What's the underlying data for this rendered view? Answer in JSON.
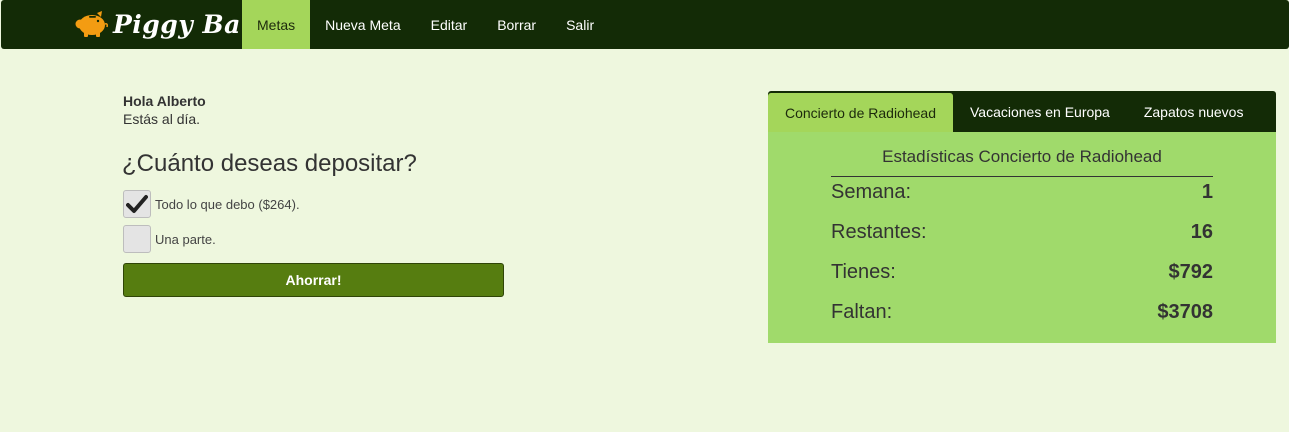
{
  "brand": {
    "name": "Piggy Bank",
    "icon": "piggy-bank-icon"
  },
  "nav": {
    "items": [
      {
        "label": "Metas",
        "active": true
      },
      {
        "label": "Nueva Meta",
        "active": false
      },
      {
        "label": "Editar",
        "active": false
      },
      {
        "label": "Borrar",
        "active": false
      },
      {
        "label": "Salir",
        "active": false
      }
    ]
  },
  "greeting": {
    "name": "Hola Alberto",
    "status": "Estás al día."
  },
  "deposit": {
    "question": "¿Cuánto deseas depositar?",
    "options": [
      {
        "label": "Todo lo que debo ($264).",
        "checked": true
      },
      {
        "label": "Una parte.",
        "checked": false
      }
    ],
    "button_label": "Ahorrar!"
  },
  "goals": {
    "tabs": [
      {
        "label": "Concierto de Radiohead",
        "active": true
      },
      {
        "label": "Vacaciones en Europa",
        "active": false
      },
      {
        "label": "Zapatos nuevos",
        "active": false
      }
    ],
    "stats": {
      "title": "Estadísticas Concierto de Radiohead",
      "rows": [
        {
          "label": "Semana:",
          "value": "1"
        },
        {
          "label": "Restantes:",
          "value": "16"
        },
        {
          "label": "Tienes:",
          "value": "$792"
        },
        {
          "label": "Faltan:",
          "value": "$3708"
        }
      ]
    }
  },
  "colors": {
    "navbar": "#132b06",
    "accent": "#a4d65a",
    "page_background": "#eef7de",
    "button": "#567d10",
    "panel": "#a0da6b",
    "brand_icon": "#f39c12"
  }
}
